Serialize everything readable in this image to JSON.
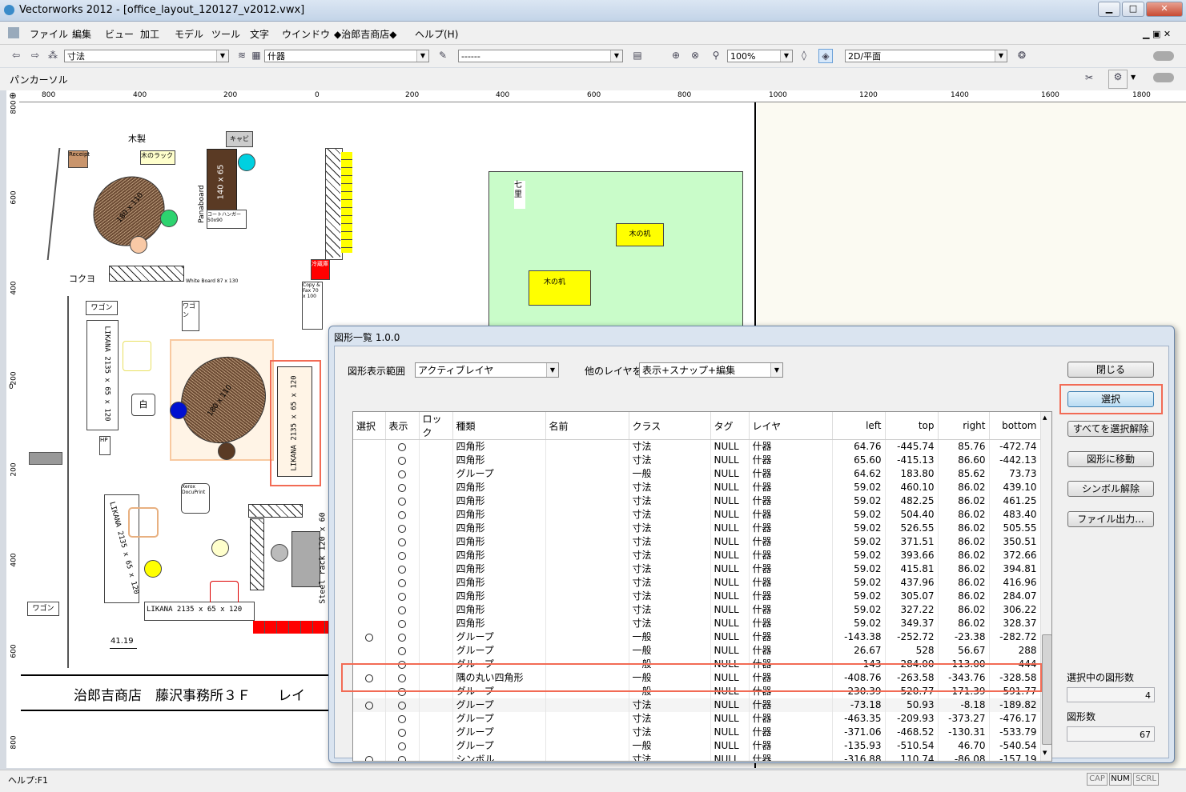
{
  "window": {
    "title": "Vectorworks 2012 - [office_layout_120127_v2012.vwx]"
  },
  "menu": [
    "ファイル",
    "編集",
    "ビュー",
    "加工",
    "モデル",
    "ツール",
    "文字",
    "ウインドウ",
    "◆治郎吉商店◆",
    "ヘルプ(H)"
  ],
  "toolbar": {
    "class_value": "寸法",
    "layer_value": "什器",
    "line_value": "------",
    "zoom_value": "100%",
    "view_value": "2D/平面"
  },
  "toolbar2": {
    "label": "パンカーソル"
  },
  "ruler": {
    "h_ticks": [
      "800",
      "400",
      "200",
      "0",
      "200",
      "400",
      "600",
      "800",
      "1000",
      "1200",
      "1400",
      "1600",
      "1800"
    ],
    "v_ticks": [
      "800",
      "600",
      "400",
      "200",
      "0",
      "200",
      "400",
      "600",
      "800"
    ]
  },
  "plan": {
    "wood_label": "木製",
    "receipt": "Receipt",
    "rack": "木のラック",
    "cabi": "キャビ",
    "table1": "180 x 110",
    "desk1": "140 x 65",
    "panaboard": "Panaboard",
    "coat": "コートハンガー 50x90",
    "kokuyo": "コクヨ",
    "whiteboard": "White Board 87 x 130",
    "wagon1": "ワゴン",
    "wagon2": "ワゴン",
    "wagon3": "ワゴン",
    "likana1": "LIKANA 2135 x 65 x 120",
    "likana2": "LIKANA 2135 x 65 x 120",
    "likana3": "LIKANA 2135 x 65 x 120",
    "likana4": "LIKANA 2135 x 65 x 120",
    "shiro": "白",
    "table2": "180 x 110",
    "hp": "HP",
    "xerox": "Xerox DocuPrint",
    "steel": "Steel rack 120 x 60",
    "dim": "41.19",
    "copier": "Copy & Fax 70 x 100",
    "red_box": "冷蔵庫",
    "nanasato": "七里",
    "desk_a": "木の机",
    "desk_b": "木の机",
    "footer_title": "治郎吉商店　藤沢事務所３Ｆ　　レイ"
  },
  "dialog": {
    "title": "図形一覧 1.0.0",
    "scope_label": "図形表示範囲",
    "scope_value": "アクティブレイヤ",
    "other_label": "他のレイヤを",
    "other_value": "表示+スナップ+編集",
    "buttons": {
      "close": "閉じる",
      "select": "選択",
      "deselect_all": "すべてを選択解除",
      "goto": "図形に移動",
      "unsymbol": "シンボル解除",
      "export": "ファイル出力..."
    },
    "selected_count_label": "選択中の図形数",
    "selected_count": "4",
    "total_label": "図形数",
    "total": "67",
    "columns": [
      "選択",
      "表示",
      "ロック",
      "種類",
      "名前",
      "クラス",
      "タグ",
      "レイヤ",
      "left",
      "top",
      "right",
      "bottom"
    ],
    "rows": [
      {
        "sel": "",
        "vis": "○",
        "type": "四角形",
        "cls": "寸法",
        "tag": "NULL",
        "layer": "什器",
        "left": "64.76",
        "top": "-445.74",
        "right": "85.76",
        "bottom": "-472.74"
      },
      {
        "sel": "",
        "vis": "○",
        "type": "四角形",
        "cls": "寸法",
        "tag": "NULL",
        "layer": "什器",
        "left": "65.60",
        "top": "-415.13",
        "right": "86.60",
        "bottom": "-442.13"
      },
      {
        "sel": "",
        "vis": "○",
        "type": "グループ",
        "cls": "一般",
        "tag": "NULL",
        "layer": "什器",
        "left": "64.62",
        "top": "183.80",
        "right": "85.62",
        "bottom": "73.73"
      },
      {
        "sel": "",
        "vis": "○",
        "type": "四角形",
        "cls": "寸法",
        "tag": "NULL",
        "layer": "什器",
        "left": "59.02",
        "top": "460.10",
        "right": "86.02",
        "bottom": "439.10"
      },
      {
        "sel": "",
        "vis": "○",
        "type": "四角形",
        "cls": "寸法",
        "tag": "NULL",
        "layer": "什器",
        "left": "59.02",
        "top": "482.25",
        "right": "86.02",
        "bottom": "461.25"
      },
      {
        "sel": "",
        "vis": "○",
        "type": "四角形",
        "cls": "寸法",
        "tag": "NULL",
        "layer": "什器",
        "left": "59.02",
        "top": "504.40",
        "right": "86.02",
        "bottom": "483.40"
      },
      {
        "sel": "",
        "vis": "○",
        "type": "四角形",
        "cls": "寸法",
        "tag": "NULL",
        "layer": "什器",
        "left": "59.02",
        "top": "526.55",
        "right": "86.02",
        "bottom": "505.55"
      },
      {
        "sel": "",
        "vis": "○",
        "type": "四角形",
        "cls": "寸法",
        "tag": "NULL",
        "layer": "什器",
        "left": "59.02",
        "top": "371.51",
        "right": "86.02",
        "bottom": "350.51"
      },
      {
        "sel": "",
        "vis": "○",
        "type": "四角形",
        "cls": "寸法",
        "tag": "NULL",
        "layer": "什器",
        "left": "59.02",
        "top": "393.66",
        "right": "86.02",
        "bottom": "372.66"
      },
      {
        "sel": "",
        "vis": "○",
        "type": "四角形",
        "cls": "寸法",
        "tag": "NULL",
        "layer": "什器",
        "left": "59.02",
        "top": "415.81",
        "right": "86.02",
        "bottom": "394.81"
      },
      {
        "sel": "",
        "vis": "○",
        "type": "四角形",
        "cls": "寸法",
        "tag": "NULL",
        "layer": "什器",
        "left": "59.02",
        "top": "437.96",
        "right": "86.02",
        "bottom": "416.96"
      },
      {
        "sel": "",
        "vis": "○",
        "type": "四角形",
        "cls": "寸法",
        "tag": "NULL",
        "layer": "什器",
        "left": "59.02",
        "top": "305.07",
        "right": "86.02",
        "bottom": "284.07"
      },
      {
        "sel": "",
        "vis": "○",
        "type": "四角形",
        "cls": "寸法",
        "tag": "NULL",
        "layer": "什器",
        "left": "59.02",
        "top": "327.22",
        "right": "86.02",
        "bottom": "306.22"
      },
      {
        "sel": "",
        "vis": "○",
        "type": "四角形",
        "cls": "寸法",
        "tag": "NULL",
        "layer": "什器",
        "left": "59.02",
        "top": "349.37",
        "right": "86.02",
        "bottom": "328.37"
      },
      {
        "sel": "○",
        "vis": "○",
        "type": "グループ",
        "cls": "一般",
        "tag": "NULL",
        "layer": "什器",
        "left": "-143.38",
        "top": "-252.72",
        "right": "-23.38",
        "bottom": "-282.72"
      },
      {
        "sel": "",
        "vis": "○",
        "type": "グループ",
        "cls": "一般",
        "tag": "NULL",
        "layer": "什器",
        "left": "26.67",
        "top": "528",
        "right": "56.67",
        "bottom": "288"
      },
      {
        "sel": "",
        "vis": "○",
        "type": "グループ",
        "cls": "一般",
        "tag": "NULL",
        "layer": "什器",
        "left": "-143",
        "top": "-284.00",
        "right": "-113.00",
        "bottom": "-444"
      },
      {
        "sel": "○",
        "vis": "○",
        "type": "隅の丸い四角形",
        "cls": "一般",
        "tag": "NULL",
        "layer": "什器",
        "left": "-408.76",
        "top": "-263.58",
        "right": "-343.76",
        "bottom": "-328.58"
      },
      {
        "sel": "",
        "vis": "○",
        "type": "グループ",
        "cls": "一般",
        "tag": "NULL",
        "layer": "什器",
        "left": "-230.39",
        "top": "-520.77",
        "right": "-171.39",
        "bottom": "-591.77"
      },
      {
        "sel": "○",
        "vis": "○",
        "type": "グループ",
        "cls": "寸法",
        "tag": "NULL",
        "layer": "什器",
        "left": "-73.18",
        "top": "50.93",
        "right": "-8.18",
        "bottom": "-189.82"
      },
      {
        "sel": "",
        "vis": "○",
        "type": "グループ",
        "cls": "寸法",
        "tag": "NULL",
        "layer": "什器",
        "left": "-463.35",
        "top": "-209.93",
        "right": "-373.27",
        "bottom": "-476.17"
      },
      {
        "sel": "",
        "vis": "○",
        "type": "グループ",
        "cls": "寸法",
        "tag": "NULL",
        "layer": "什器",
        "left": "-371.06",
        "top": "-468.52",
        "right": "-130.31",
        "bottom": "-533.79"
      },
      {
        "sel": "",
        "vis": "○",
        "type": "グループ",
        "cls": "一般",
        "tag": "NULL",
        "layer": "什器",
        "left": "-135.93",
        "top": "-510.54",
        "right": "46.70",
        "bottom": "-540.54"
      },
      {
        "sel": "○",
        "vis": "○",
        "type": "シンボル",
        "cls": "寸法",
        "tag": "NULL",
        "layer": "什器",
        "left": "-316.88",
        "top": "110.74",
        "right": "-86.08",
        "bottom": "-157.19"
      }
    ]
  },
  "status": {
    "help": "ヘルプ:F1",
    "cap": "CAP",
    "num": "NUM",
    "scrl": "SCRL"
  },
  "colors": {
    "highlight": "#f26b55",
    "green_area": "#c9fcc9",
    "yellow": "#ffff00",
    "red": "#ff0000"
  }
}
